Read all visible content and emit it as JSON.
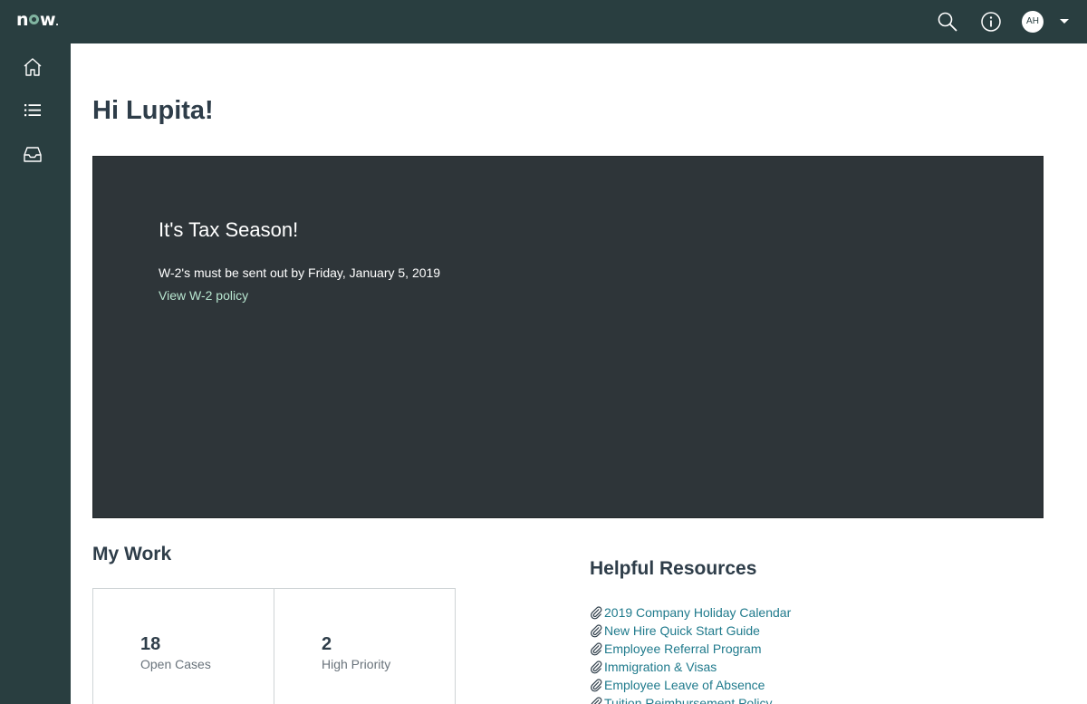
{
  "header": {
    "logo_prefix": "n",
    "logo_suffix": "w",
    "avatar_initials": "AH",
    "icons": [
      "search-icon",
      "info-icon",
      "chevron-down-icon"
    ]
  },
  "sidenav": {
    "items": [
      {
        "icon": "home-icon"
      },
      {
        "icon": "list-icon"
      },
      {
        "icon": "inbox-icon"
      }
    ]
  },
  "greeting": "Hi Lupita!",
  "banner": {
    "title": "It's Tax Season!",
    "text": "W-2's must be sent out by Friday, January 5, 2019",
    "link": "View W-2 policy"
  },
  "my_work": {
    "title": "My Work",
    "cards": [
      {
        "count": "18",
        "label": "Open Cases"
      },
      {
        "count": "2",
        "label": "High Priority"
      }
    ]
  },
  "resources": {
    "title": "Helpful Resources",
    "items": [
      "2019 Company Holiday Calendar",
      "New Hire Quick Start Guide",
      "Employee Referral Program",
      "Immigration & Visas",
      "Employee Leave of Absence",
      "Tuition Reimbursement Policy"
    ]
  },
  "colors": {
    "header_bg": "#293e40",
    "banner_bg": "#2e3539",
    "link": "#1f7a8c",
    "banner_link": "#b8e6d0"
  }
}
